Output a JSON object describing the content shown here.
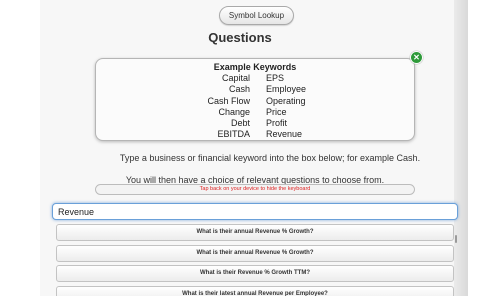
{
  "header": {
    "symbol_lookup_label": "Symbol Lookup",
    "page_title": "Questions"
  },
  "keywords": {
    "title": "Example Keywords",
    "rows": [
      {
        "left": "Capital",
        "right": "EPS"
      },
      {
        "left": "Cash",
        "right": "Employee"
      },
      {
        "left": "Cash Flow",
        "right": "Operating"
      },
      {
        "left": "Change",
        "right": "Price"
      },
      {
        "left": "Debt",
        "right": "Profit"
      },
      {
        "left": "EBITDA",
        "right": "Revenue"
      }
    ],
    "close_icon": "close-icon"
  },
  "instructions": {
    "line1": "Type a business or financial keyword into the box below; for example Cash.",
    "line2": "You will then have a choice of relevant questions to choose from.",
    "hide_keyboard": "Tap back on your device to hide the keyboard"
  },
  "search": {
    "value": "Revenue",
    "placeholder": ""
  },
  "suggestions": [
    "What is their annual Revenue % Growth?",
    "What is their annual Revenue % Growth?",
    "What is their Revenue % Growth TTM?",
    "What is their latest annual Revenue per Employee?"
  ],
  "colors": {
    "close_button": "#2e9a3a",
    "hint_text": "#dd2222",
    "input_focus": "#6aa0d9"
  }
}
